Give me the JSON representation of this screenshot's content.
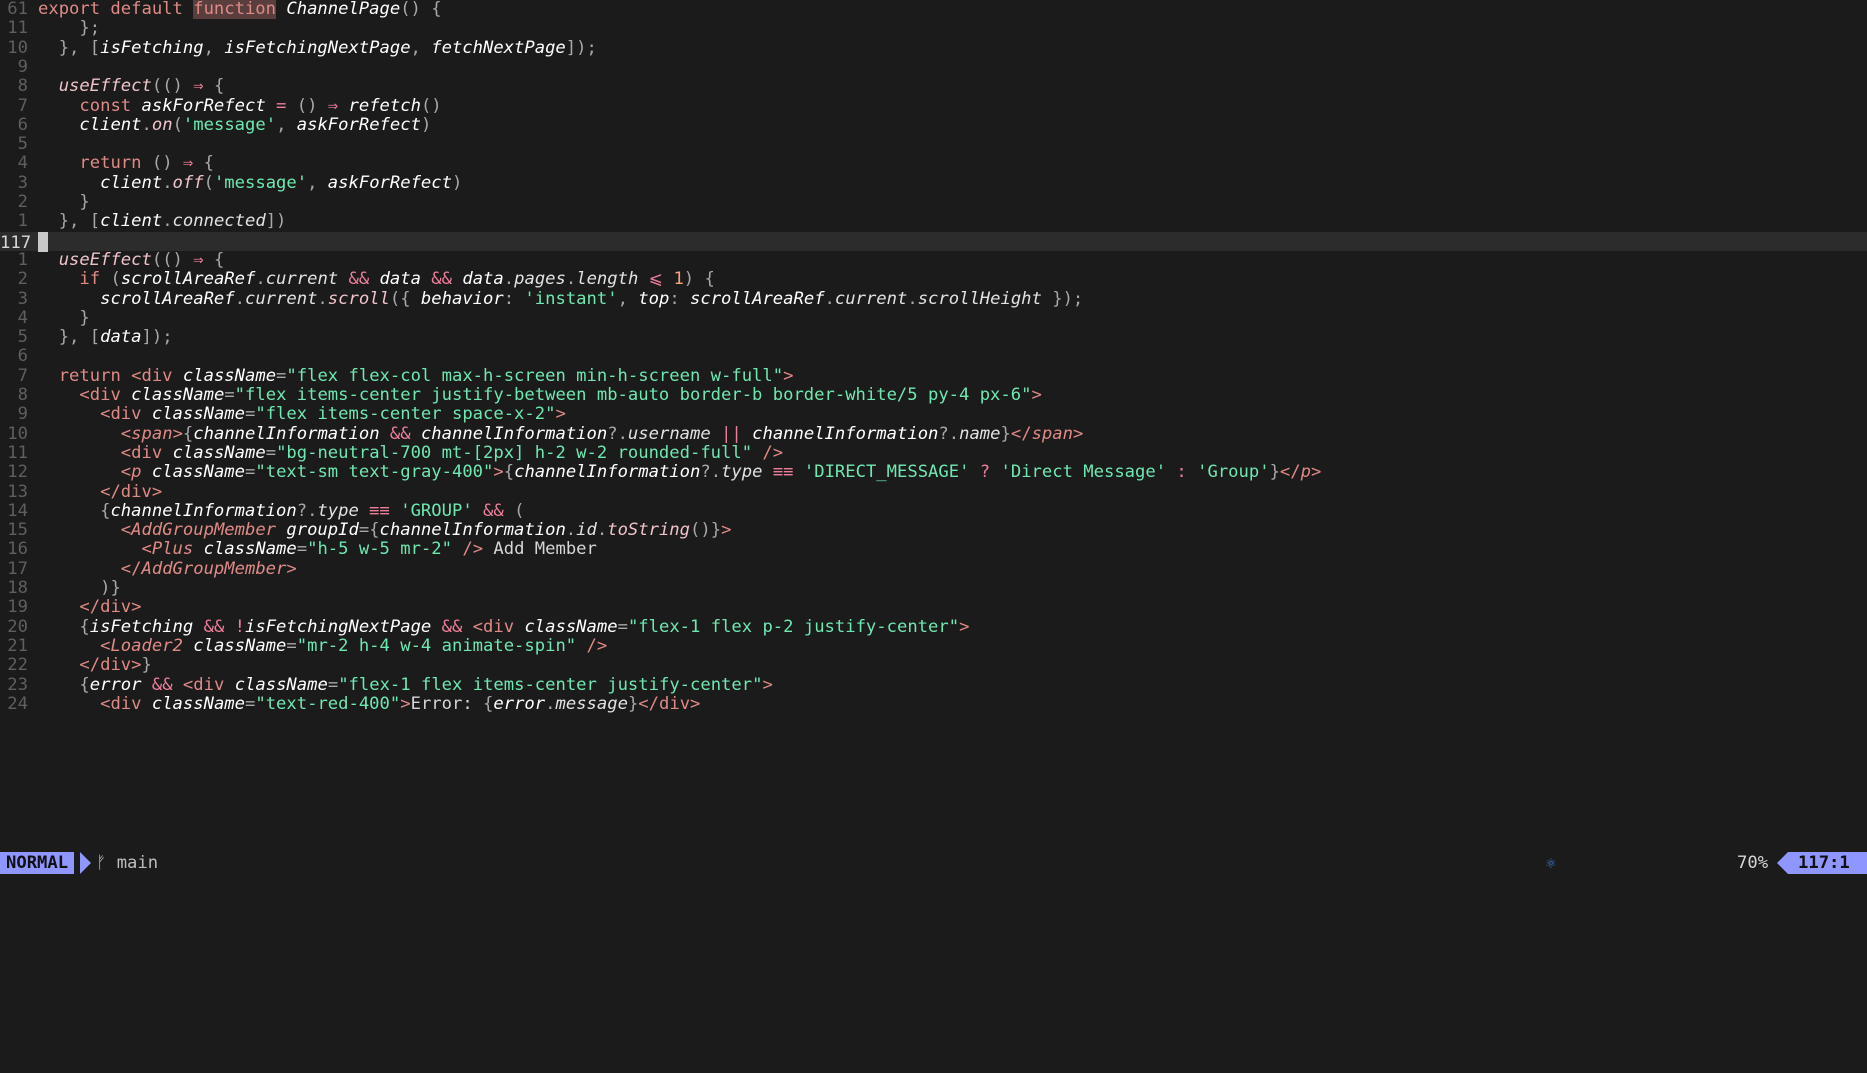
{
  "editor": {
    "lines": [
      {
        "num": "61",
        "tokens": [
          [
            "keyword",
            "export default "
          ],
          [
            "hl",
            "function"
          ],
          [
            "plain",
            " "
          ],
          [
            "fnname",
            "ChannelPage"
          ],
          [
            "punc",
            "() {"
          ]
        ]
      },
      {
        "num": "11",
        "tokens": [
          [
            "punc",
            "    };"
          ]
        ]
      },
      {
        "num": "10",
        "tokens": [
          [
            "punc",
            "  }, ["
          ],
          [
            "var",
            "isFetching"
          ],
          [
            "punc",
            ", "
          ],
          [
            "var",
            "isFetchingNextPage"
          ],
          [
            "punc",
            ", "
          ],
          [
            "var",
            "fetchNextPage"
          ],
          [
            "punc",
            "]);"
          ]
        ]
      },
      {
        "num": "9",
        "tokens": []
      },
      {
        "num": "8",
        "tokens": [
          [
            "plain",
            "  "
          ],
          [
            "func",
            "useEffect"
          ],
          [
            "punc",
            "(() "
          ],
          [
            "op",
            "⇒"
          ],
          [
            "punc",
            " {"
          ]
        ]
      },
      {
        "num": "7",
        "tokens": [
          [
            "plain",
            "    "
          ],
          [
            "keyword",
            "const "
          ],
          [
            "var",
            "askForRefect"
          ],
          [
            "op",
            " = "
          ],
          [
            "punc",
            "() "
          ],
          [
            "op",
            "⇒"
          ],
          [
            "plain",
            " "
          ],
          [
            "call",
            "refetch"
          ],
          [
            "punc",
            "()"
          ]
        ]
      },
      {
        "num": "6",
        "tokens": [
          [
            "plain",
            "    "
          ],
          [
            "var",
            "client"
          ],
          [
            "punc",
            "."
          ],
          [
            "func",
            "on"
          ],
          [
            "punc",
            "("
          ],
          [
            "str",
            "'message'"
          ],
          [
            "punc",
            ", "
          ],
          [
            "var",
            "askForRefect"
          ],
          [
            "punc",
            ")"
          ]
        ]
      },
      {
        "num": "5",
        "tokens": []
      },
      {
        "num": "4",
        "tokens": [
          [
            "plain",
            "    "
          ],
          [
            "keyword",
            "return "
          ],
          [
            "punc",
            "() "
          ],
          [
            "op",
            "⇒"
          ],
          [
            "punc",
            " {"
          ]
        ]
      },
      {
        "num": "3",
        "tokens": [
          [
            "plain",
            "      "
          ],
          [
            "var",
            "client"
          ],
          [
            "punc",
            "."
          ],
          [
            "func",
            "off"
          ],
          [
            "punc",
            "("
          ],
          [
            "str",
            "'message'"
          ],
          [
            "punc",
            ", "
          ],
          [
            "var",
            "askForRefect"
          ],
          [
            "punc",
            ")"
          ]
        ]
      },
      {
        "num": "2",
        "tokens": [
          [
            "punc",
            "    }"
          ]
        ]
      },
      {
        "num": "1",
        "tokens": [
          [
            "punc",
            "  }, ["
          ],
          [
            "var",
            "client"
          ],
          [
            "punc",
            "."
          ],
          [
            "prop",
            "connected"
          ],
          [
            "punc",
            "])"
          ]
        ]
      },
      {
        "num": "117",
        "current": true,
        "tokens": []
      },
      {
        "num": "1",
        "tokens": [
          [
            "plain",
            "  "
          ],
          [
            "func",
            "useEffect"
          ],
          [
            "punc",
            "(() "
          ],
          [
            "op",
            "⇒"
          ],
          [
            "punc",
            " {"
          ]
        ]
      },
      {
        "num": "2",
        "tokens": [
          [
            "plain",
            "    "
          ],
          [
            "keyword",
            "if "
          ],
          [
            "punc",
            "("
          ],
          [
            "var",
            "scrollAreaRef"
          ],
          [
            "punc",
            "."
          ],
          [
            "prop",
            "current"
          ],
          [
            "op",
            " && "
          ],
          [
            "var",
            "data"
          ],
          [
            "op",
            " && "
          ],
          [
            "var",
            "data"
          ],
          [
            "punc",
            "."
          ],
          [
            "prop",
            "pages"
          ],
          [
            "punc",
            "."
          ],
          [
            "prop",
            "length"
          ],
          [
            "op",
            " ⩽ "
          ],
          [
            "num",
            "1"
          ],
          [
            "punc",
            ") {"
          ]
        ]
      },
      {
        "num": "3",
        "tokens": [
          [
            "plain",
            "      "
          ],
          [
            "var",
            "scrollAreaRef"
          ],
          [
            "punc",
            "."
          ],
          [
            "prop",
            "current"
          ],
          [
            "punc",
            "."
          ],
          [
            "func",
            "scroll"
          ],
          [
            "punc",
            "({ "
          ],
          [
            "attr",
            "behavior"
          ],
          [
            "punc",
            ": "
          ],
          [
            "str",
            "'instant'"
          ],
          [
            "punc",
            ", "
          ],
          [
            "attr",
            "top"
          ],
          [
            "punc",
            ": "
          ],
          [
            "var",
            "scrollAreaRef"
          ],
          [
            "punc",
            "."
          ],
          [
            "prop",
            "current"
          ],
          [
            "punc",
            "."
          ],
          [
            "prop",
            "scrollHeight"
          ],
          [
            "punc",
            " });"
          ]
        ]
      },
      {
        "num": "4",
        "tokens": [
          [
            "punc",
            "    }"
          ]
        ]
      },
      {
        "num": "5",
        "tokens": [
          [
            "punc",
            "  }, ["
          ],
          [
            "var",
            "data"
          ],
          [
            "punc",
            "]);"
          ]
        ]
      },
      {
        "num": "6",
        "tokens": []
      },
      {
        "num": "7",
        "tokens": [
          [
            "plain",
            "  "
          ],
          [
            "keyword",
            "return "
          ],
          [
            "tag",
            "<div"
          ],
          [
            "plain",
            " "
          ],
          [
            "attr",
            "className"
          ],
          [
            "punc",
            "="
          ],
          [
            "str",
            "\"flex flex-col max-h-screen min-h-screen w-full\""
          ],
          [
            "tag",
            ">"
          ]
        ]
      },
      {
        "num": "8",
        "tokens": [
          [
            "plain",
            "    "
          ],
          [
            "tag",
            "<div"
          ],
          [
            "plain",
            " "
          ],
          [
            "attr",
            "className"
          ],
          [
            "punc",
            "="
          ],
          [
            "str",
            "\"flex items-center justify-between mb-auto border-b border-white/5 py-4 px-6\""
          ],
          [
            "tag",
            ">"
          ]
        ]
      },
      {
        "num": "9",
        "tokens": [
          [
            "plain",
            "      "
          ],
          [
            "tag",
            "<div"
          ],
          [
            "plain",
            " "
          ],
          [
            "attr",
            "className"
          ],
          [
            "punc",
            "="
          ],
          [
            "str",
            "\"flex items-center space-x-2\""
          ],
          [
            "tag",
            ">"
          ]
        ]
      },
      {
        "num": "10",
        "tokens": [
          [
            "plain",
            "        "
          ],
          [
            "tag",
            "<"
          ],
          [
            "comp",
            "span"
          ],
          [
            "tag",
            ">"
          ],
          [
            "punc",
            "{"
          ],
          [
            "var",
            "channelInformation"
          ],
          [
            "op",
            " && "
          ],
          [
            "var",
            "channelInformation"
          ],
          [
            "punc",
            "?."
          ],
          [
            "prop",
            "username"
          ],
          [
            "op",
            " || "
          ],
          [
            "var",
            "channelInformation"
          ],
          [
            "punc",
            "?."
          ],
          [
            "prop",
            "name"
          ],
          [
            "punc",
            "}"
          ],
          [
            "tag",
            "</"
          ],
          [
            "comp",
            "span"
          ],
          [
            "tag",
            ">"
          ]
        ]
      },
      {
        "num": "11",
        "tokens": [
          [
            "plain",
            "        "
          ],
          [
            "tag",
            "<div"
          ],
          [
            "plain",
            " "
          ],
          [
            "attr",
            "className"
          ],
          [
            "punc",
            "="
          ],
          [
            "str",
            "\"bg-neutral-700 mt-[2px] h-2 w-2 rounded-full\""
          ],
          [
            "plain",
            " "
          ],
          [
            "tag",
            "/>"
          ]
        ]
      },
      {
        "num": "12",
        "tokens": [
          [
            "plain",
            "        "
          ],
          [
            "tag",
            "<"
          ],
          [
            "comp",
            "p"
          ],
          [
            "plain",
            " "
          ],
          [
            "attr",
            "className"
          ],
          [
            "punc",
            "="
          ],
          [
            "str",
            "\"text-sm text-gray-400\""
          ],
          [
            "tag",
            ">"
          ],
          [
            "punc",
            "{"
          ],
          [
            "var",
            "channelInformation"
          ],
          [
            "punc",
            "?."
          ],
          [
            "prop",
            "type"
          ],
          [
            "op",
            " ≡≡ "
          ],
          [
            "str",
            "'DIRECT_MESSAGE'"
          ],
          [
            "op",
            " ? "
          ],
          [
            "str",
            "'Direct Message'"
          ],
          [
            "op",
            " : "
          ],
          [
            "str",
            "'Group'"
          ],
          [
            "punc",
            "}"
          ],
          [
            "tag",
            "</"
          ],
          [
            "comp",
            "p"
          ],
          [
            "tag",
            ">"
          ]
        ]
      },
      {
        "num": "13",
        "tokens": [
          [
            "plain",
            "      "
          ],
          [
            "tag",
            "</div>"
          ]
        ]
      },
      {
        "num": "14",
        "tokens": [
          [
            "plain",
            "      "
          ],
          [
            "punc",
            "{"
          ],
          [
            "var",
            "channelInformation"
          ],
          [
            "punc",
            "?."
          ],
          [
            "prop",
            "type"
          ],
          [
            "op",
            " ≡≡ "
          ],
          [
            "str",
            "'GROUP'"
          ],
          [
            "op",
            " && "
          ],
          [
            "punc",
            "("
          ]
        ]
      },
      {
        "num": "15",
        "tokens": [
          [
            "plain",
            "        "
          ],
          [
            "tag",
            "<"
          ],
          [
            "comp",
            "AddGroupMember"
          ],
          [
            "plain",
            " "
          ],
          [
            "attr",
            "groupId"
          ],
          [
            "punc",
            "={"
          ],
          [
            "var",
            "channelInformation"
          ],
          [
            "punc",
            "."
          ],
          [
            "prop",
            "id"
          ],
          [
            "punc",
            "."
          ],
          [
            "func",
            "toString"
          ],
          [
            "punc",
            "()}"
          ],
          [
            "tag",
            ">"
          ]
        ]
      },
      {
        "num": "16",
        "tokens": [
          [
            "plain",
            "          "
          ],
          [
            "tag",
            "<"
          ],
          [
            "comp",
            "Plus"
          ],
          [
            "plain",
            " "
          ],
          [
            "attr",
            "className"
          ],
          [
            "punc",
            "="
          ],
          [
            "str",
            "\"h-5 w-5 mr-2\""
          ],
          [
            "plain",
            " "
          ],
          [
            "tag",
            "/>"
          ],
          [
            "plain",
            " Add Member"
          ]
        ]
      },
      {
        "num": "17",
        "tokens": [
          [
            "plain",
            "        "
          ],
          [
            "tag",
            "</"
          ],
          [
            "comp",
            "AddGroupMember"
          ],
          [
            "tag",
            ">"
          ]
        ]
      },
      {
        "num": "18",
        "tokens": [
          [
            "plain",
            "      "
          ],
          [
            "punc",
            ")}"
          ]
        ]
      },
      {
        "num": "19",
        "tokens": [
          [
            "plain",
            "    "
          ],
          [
            "tag",
            "</div>"
          ]
        ]
      },
      {
        "num": "20",
        "tokens": [
          [
            "plain",
            "    "
          ],
          [
            "punc",
            "{"
          ],
          [
            "var",
            "isFetching"
          ],
          [
            "op",
            " && !"
          ],
          [
            "var",
            "isFetchingNextPage"
          ],
          [
            "op",
            " && "
          ],
          [
            "tag",
            "<div"
          ],
          [
            "plain",
            " "
          ],
          [
            "attr",
            "className"
          ],
          [
            "punc",
            "="
          ],
          [
            "str",
            "\"flex-1 flex p-2 justify-center\""
          ],
          [
            "tag",
            ">"
          ]
        ]
      },
      {
        "num": "21",
        "tokens": [
          [
            "plain",
            "      "
          ],
          [
            "tag",
            "<"
          ],
          [
            "comp",
            "Loader2"
          ],
          [
            "plain",
            " "
          ],
          [
            "attr",
            "className"
          ],
          [
            "punc",
            "="
          ],
          [
            "str",
            "\"mr-2 h-4 w-4 animate-spin\""
          ],
          [
            "plain",
            " "
          ],
          [
            "tag",
            "/>"
          ]
        ]
      },
      {
        "num": "22",
        "tokens": [
          [
            "plain",
            "    "
          ],
          [
            "tag",
            "</div>"
          ],
          [
            "punc",
            "}"
          ]
        ]
      },
      {
        "num": "23",
        "tokens": [
          [
            "plain",
            "    "
          ],
          [
            "punc",
            "{"
          ],
          [
            "var",
            "error"
          ],
          [
            "op",
            " && "
          ],
          [
            "tag",
            "<div"
          ],
          [
            "plain",
            " "
          ],
          [
            "attr",
            "className"
          ],
          [
            "punc",
            "="
          ],
          [
            "str",
            "\"flex-1 flex items-center justify-center\""
          ],
          [
            "tag",
            ">"
          ]
        ]
      },
      {
        "num": "24",
        "tokens": [
          [
            "plain",
            "      "
          ],
          [
            "tag",
            "<div"
          ],
          [
            "plain",
            " "
          ],
          [
            "attr",
            "className"
          ],
          [
            "punc",
            "="
          ],
          [
            "str",
            "\"text-red-400\""
          ],
          [
            "tag",
            ">"
          ],
          [
            "plain",
            "Error: "
          ],
          [
            "punc",
            "{"
          ],
          [
            "var",
            "error"
          ],
          [
            "punc",
            "."
          ],
          [
            "prop",
            "message"
          ],
          [
            "punc",
            "}"
          ],
          [
            "tag",
            "</div>"
          ]
        ]
      }
    ]
  },
  "statusbar": {
    "mode": "NORMAL",
    "branch_icon": "git-branch-icon",
    "branch": "main",
    "lsp_icon": "react-icon",
    "percent": "70%",
    "position": "117:1"
  },
  "colors": {
    "mode_bg": "#8f96ff",
    "background": "#1b1b1b",
    "current_line": "#2c2c2c"
  }
}
